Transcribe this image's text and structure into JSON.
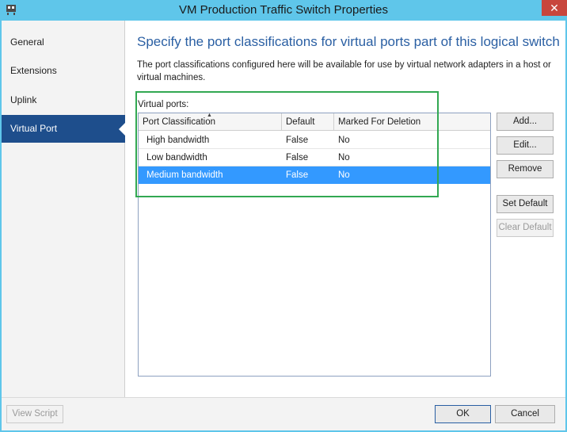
{
  "window": {
    "title": "VM Production Traffic Switch Properties",
    "close_label": "✕"
  },
  "sidebar": {
    "items": [
      {
        "label": "General",
        "active": false
      },
      {
        "label": "Extensions",
        "active": false
      },
      {
        "label": "Uplink",
        "active": false
      },
      {
        "label": "Virtual Port",
        "active": true
      }
    ]
  },
  "main": {
    "heading": "Specify the port classifications for virtual ports part of this logical switch",
    "description": "The port classifications configured here will be available for use by virtual network adapters in a host or virtual machines.",
    "grid_label": "Virtual ports:",
    "columns": [
      "Port Classification",
      "Default",
      "Marked For Deletion"
    ],
    "sort_indicator": "▲",
    "rows": [
      {
        "classification": "High bandwidth",
        "default": "False",
        "marked": "No",
        "selected": false
      },
      {
        "classification": "Low bandwidth",
        "default": "False",
        "marked": "No",
        "selected": false
      },
      {
        "classification": "Medium bandwidth",
        "default": "False",
        "marked": "No",
        "selected": true
      }
    ]
  },
  "buttons": {
    "add": "Add...",
    "edit": "Edit...",
    "remove": "Remove",
    "set_default": "Set Default",
    "clear_default": "Clear Default"
  },
  "footer": {
    "view_script": "View Script",
    "ok": "OK",
    "cancel": "Cancel"
  },
  "colors": {
    "title_bar": "#5fc6ea",
    "active_nav": "#1e4e8c",
    "heading": "#2a5fa3",
    "selection": "#3399ff",
    "highlight": "#32a852",
    "close_button": "#c8463d"
  }
}
